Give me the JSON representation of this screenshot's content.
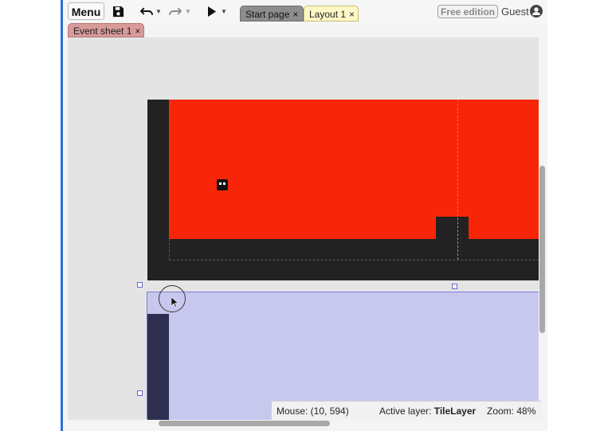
{
  "toolbar": {
    "menu_label": "Menu",
    "save_icon": "save-icon",
    "undo_icon": "undo-icon",
    "redo_icon": "redo-icon",
    "play_icon": "play-icon",
    "free_edition": "Free edition",
    "guest_label": "Guest",
    "user_icon": "user-circle-icon"
  },
  "tabs": {
    "start_page": "Start page",
    "layout": "Layout 1",
    "event_sheet": "Event sheet 1",
    "close_glyph": "×"
  },
  "status": {
    "mouse": "Mouse: (10, 594)",
    "active_layer_label": "Active layer:",
    "active_layer_value": "TileLayer",
    "zoom": "Zoom: 48%"
  },
  "colors": {
    "accent": "#2f6fd6",
    "layout_red": "#f92508",
    "tile_dark": "#222222",
    "selected_layer": "#c8c8ee"
  }
}
